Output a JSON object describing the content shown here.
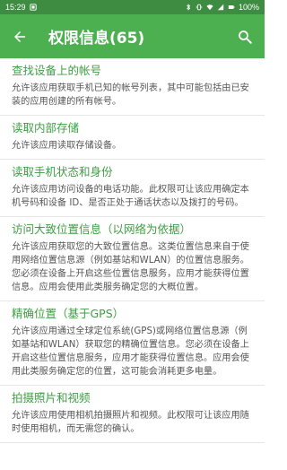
{
  "status_bar": {
    "time": "15:29",
    "battery": "100%",
    "icons": [
      "notification-icon",
      "bluetooth-icon",
      "vibrate-icon",
      "wifi-icon",
      "signal-icon",
      "battery-icon"
    ]
  },
  "app_bar": {
    "title": "权限信息(65)",
    "back_icon": "arrow-left-icon",
    "search_icon": "search-icon",
    "color": "#4caf50"
  },
  "permissions": [
    {
      "title": "查找设备上的帐号",
      "desc": "允许该应用获取手机已知的帐号列表，其中可能包括由已安装的应用创建的所有帐号。"
    },
    {
      "title": "读取内部存储",
      "desc": "允许该应用读取存储设备。"
    },
    {
      "title": "读取手机状态和身份",
      "desc": "允许该应用访问设备的电话功能。此权限可让该应用确定本机号码和设备 ID、是否正处于通话状态以及拨打的号码。"
    },
    {
      "title": "访问大致位置信息（以网络为依据）",
      "desc": "允许该应用获取您的大致位置信息。这类位置信息来自于使用网络位置信息源（例如基站和WLAN）的位置信息服务。您必须在设备上开启这些位置信息服务，应用才能获得位置信息。应用会使用此类服务确定您的大概位置。"
    },
    {
      "title": "精确位置（基于GPS）",
      "desc": "允许该应用通过全球定位系统(GPS)或网络位置信息源（例如基站和WLAN）获取您的精确位置信息。您必须在设备上开启这些位置信息服务，应用才能获得位置信息。应用会使用此类服务确定您的位置，这可能会消耗更多电量。"
    },
    {
      "title": "拍摄照片和视频",
      "desc": "允许该应用使用相机拍摄照片和视频。此权限可让该应用随时使用相机，而无需您的确认。"
    }
  ]
}
